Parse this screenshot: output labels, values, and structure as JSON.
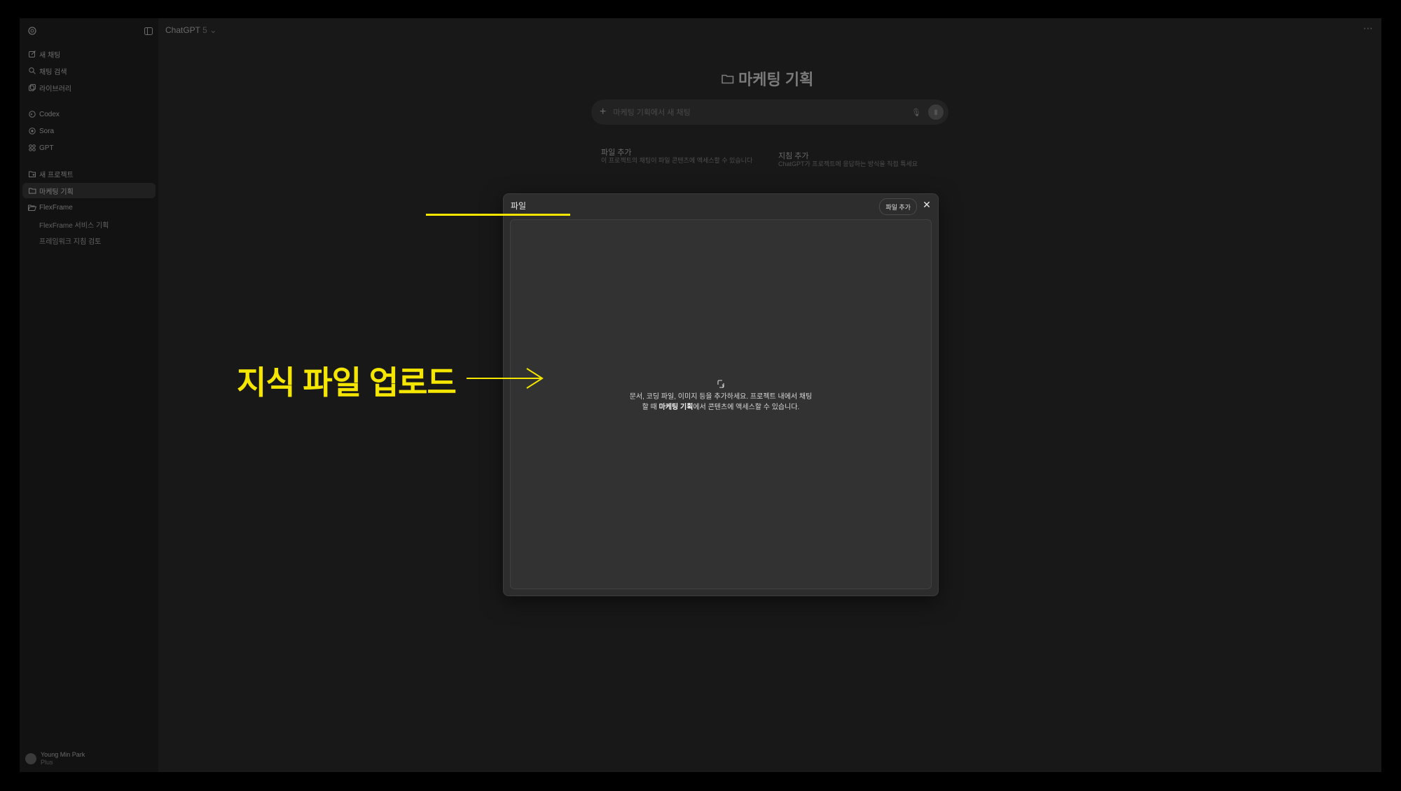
{
  "sidebar": {
    "items": [
      {
        "label": "새 채팅",
        "icon": "edit-icon"
      },
      {
        "label": "채팅 검색",
        "icon": "search-icon"
      },
      {
        "label": "라이브러리",
        "icon": "library-icon"
      },
      {
        "label": "Codex",
        "icon": "codex-icon"
      },
      {
        "label": "Sora",
        "icon": "sora-icon"
      },
      {
        "label": "GPT",
        "icon": "grid-icon"
      },
      {
        "label": "새 프로젝트",
        "icon": "new-folder-icon"
      },
      {
        "label": "마케팅 기획",
        "icon": "folder-icon"
      },
      {
        "label": "FlexFrame",
        "icon": "folder-open-icon"
      }
    ],
    "subitems": [
      "FlexFrame 서비스 기획",
      "프레임워크 지침 검토"
    ],
    "user": {
      "name": "Young Min Park",
      "plan": "Plus"
    }
  },
  "header": {
    "model": "ChatGPT",
    "model_version": "5"
  },
  "project": {
    "title": "마케팅 기획"
  },
  "composer": {
    "placeholder": "마케팅 기획에서 새 채팅"
  },
  "cards": [
    {
      "title": "파일 추가",
      "desc": "이 프로젝트의 채팅이 파일 콘텐츠에 액세스할 수 있습니다"
    },
    {
      "title": "지침 추가",
      "desc": "ChatGPT가 프로젝트에 응답하는 방식을 직접 특세요"
    }
  ],
  "modal": {
    "title": "파일",
    "add_button": "파일 추가",
    "help_pre": "문서, 코딩 파일, 이미지 등을 추가하세요. 프로젝트 내에서 채팅할 때 ",
    "help_bold": "마케팅 기획",
    "help_post": "에서 콘텐츠에 액세스할 수 있습니다."
  },
  "annotation": {
    "label": "지식 파일 업로드",
    "color": "#f5e600"
  }
}
